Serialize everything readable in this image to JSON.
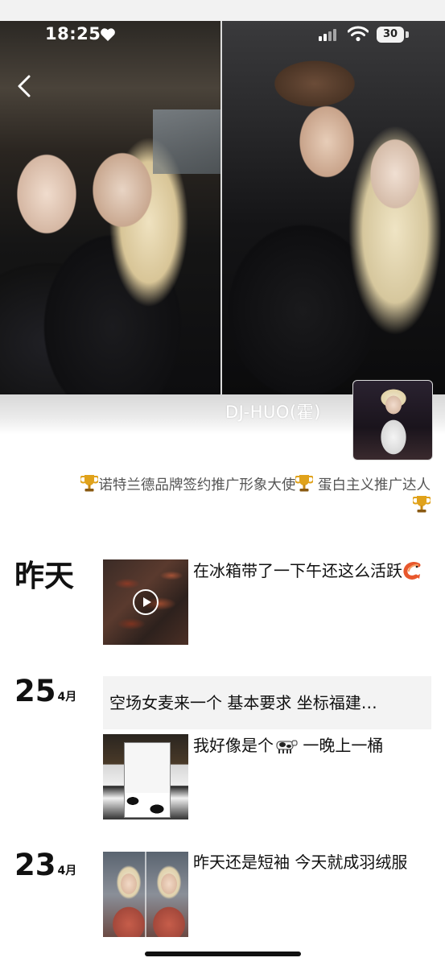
{
  "status_bar": {
    "time": "18:25",
    "battery": "30"
  },
  "profile": {
    "username": "DJ-HUO(霍)",
    "bio_line1": "诺特兰德品牌签约推广形象大使",
    "bio_line1b": "蛋白主义推广达人"
  },
  "feed": [
    {
      "day": "昨天",
      "month": "",
      "caption_text": "在冰箱带了一下午还这么活跃",
      "has_video": true
    },
    {
      "day": "25",
      "month": "4月",
      "text_post": "空场女麦来一个  基本要求  坐标福建…",
      "caption_a": "我好像是个",
      "caption_b": " 一晚上一桶"
    },
    {
      "day": "23",
      "month": "4月",
      "caption_text": "昨天还是短袖 今天就成羽绒服"
    }
  ],
  "icons": {
    "heart": "heart-icon",
    "signal": "cellular-signal-icon",
    "wifi": "wifi-icon",
    "back": "chevron-left-icon",
    "trophy": "trophy-icon",
    "play": "play-icon",
    "shrimp": "shrimp-icon",
    "cow": "cow-icon"
  },
  "colors": {
    "text": "#111111",
    "bio": "#555555",
    "trophy": "#e0a21b",
    "text_post_bg": "#f3f3f3"
  }
}
